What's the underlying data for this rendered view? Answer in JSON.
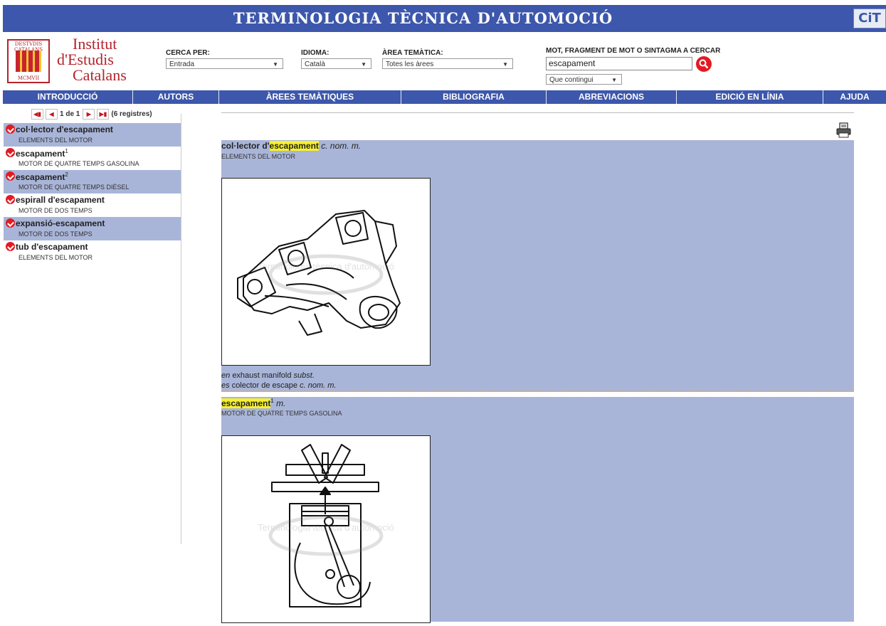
{
  "header": {
    "title": "TERMINOLOGIA TÈCNICA D'AUTOMOCIÓ",
    "badge": "CiT",
    "logo_lines": [
      "Institut",
      "d'Estudis",
      "Catalans"
    ],
    "shield_top": "DESTVDIS CATALANS",
    "shield_bottom": "MCMVII"
  },
  "search": {
    "cerca_label": "CERCA PER:",
    "cerca_value": "Entrada",
    "idioma_label": "IDIOMA:",
    "idioma_value": "Català",
    "area_label": "ÀREA TEMÀTICA:",
    "area_value": "Totes les àrees",
    "mot_label": "MOT, FRAGMENT DE MOT O SINTAGMA A CERCAR",
    "query": "escapament",
    "mode_value": "Que contingui"
  },
  "nav": [
    "INTRODUCCIÓ",
    "AUTORS",
    "ÀREES TEMÀTIQUES",
    "BIBLIOGRAFIA",
    "ABREVIACIONS",
    "EDICIÓ EN LÍNIA",
    "AJUDA"
  ],
  "pager": {
    "page": "1 de 1",
    "count": "(6 registres)"
  },
  "results": [
    {
      "term": "col·lector d'escapament",
      "sup": "",
      "area": "ELEMENTS DEL MOTOR"
    },
    {
      "term": "escapament",
      "sup": "1",
      "area": "MOTOR DE QUATRE TEMPS GASOLINA"
    },
    {
      "term": "escapament",
      "sup": "2",
      "area": "MOTOR DE QUATRE TEMPS DIÈSEL"
    },
    {
      "term": "espirall d'escapament",
      "sup": "",
      "area": "MOTOR DE DOS TEMPS"
    },
    {
      "term": "expansió-escapament",
      "sup": "",
      "area": "MOTOR DE DOS TEMPS"
    },
    {
      "term": "tub d'escapament",
      "sup": "",
      "area": "ELEMENTS DEL MOTOR"
    }
  ],
  "entries": [
    {
      "prefix": "col·lector d'",
      "highlight": "escapament",
      "sup": "",
      "gram": "c. nom. m.",
      "area": "ELEMENTS DEL MOTOR",
      "watermark": "Terminologia tècnica d'automoció",
      "eq_en_lang": "en",
      "eq_en": "exhaust manifold",
      "eq_en_gram": "subst.",
      "eq_es_lang": "es",
      "eq_es": "colector de escape",
      "eq_es_gram": "c. nom. m."
    },
    {
      "prefix": "",
      "highlight": "escapament",
      "sup": "1",
      "gram": "m.",
      "area": "MOTOR DE QUATRE TEMPS GASOLINA",
      "watermark": "Terminologia tècnica d'automoció"
    }
  ],
  "colors": {
    "bar": "#3c57ab",
    "panel": "#a9b5d8",
    "highlight": "#f6f12c",
    "accent": "#e21b23"
  }
}
